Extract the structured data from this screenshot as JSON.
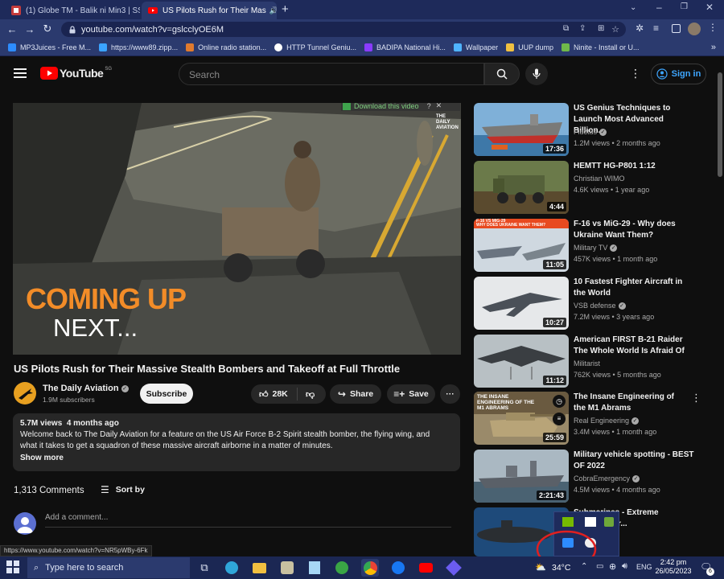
{
  "browser": {
    "tabs": [
      {
        "label": "(1) Globe TM - Balik ni Min3 | SS",
        "active": false
      },
      {
        "label": "US Pilots Rush for Their Mas",
        "active": true
      }
    ],
    "url": "youtube.com/watch?v=gslcclyOE6M",
    "bookmarks": [
      "MP3Juices - Free M...",
      "https://www89.zipp...",
      "Online radio station...",
      "HTTP Tunnel Geniu...",
      "BADIPA National Hi...",
      "Wallpaper",
      "UUP dump",
      "Ninite - Install or U..."
    ],
    "status_url": "https://www.youtube.com/watch?v=NR5pWBy-6Fk"
  },
  "youtube": {
    "logo": "YouTube",
    "region": "SG",
    "search_placeholder": "Search",
    "signin": "Sign in"
  },
  "player": {
    "download_label": "Download this video",
    "overlay_line1": "COMING UP",
    "overlay_line2": "NEXT...",
    "watermark_line1": "THE",
    "watermark_line2": "DAILY",
    "watermark_line3": "AVIATION"
  },
  "video": {
    "title": "US Pilots Rush for Their Massive Stealth Bombers and Takeoff at Full Throttle",
    "channel": "The Daily Aviation",
    "subscribers": "1.9M subscribers",
    "subscribe": "Subscribe",
    "likes": "28K",
    "share": "Share",
    "save": "Save",
    "views": "5.7M views",
    "age": "4 months ago",
    "description": "Welcome back to The Daily Aviation for a feature on the US Air Force B-2 Spirit stealth bomber, the flying wing, and what it takes to get a squadron of these massive aircraft airborne in a matter of minutes.",
    "show_more": "Show more",
    "comments_count": "1,313 Comments",
    "sort_by": "Sort by",
    "add_comment": "Add a comment..."
  },
  "recommendations": [
    {
      "title": "US Genius Techniques to Launch Most Advanced Billion...",
      "channel": "Fluctus",
      "meta": "1.2M views • 2 months ago",
      "duration": "17:36",
      "verified": true
    },
    {
      "title": "HEMTT HG-P801 1:12",
      "channel": "Christian WIMO",
      "meta": "4.6K views • 1 year ago",
      "duration": "4:44",
      "verified": false
    },
    {
      "title": "F-16 vs MiG-29 - Why does Ukraine Want Them?",
      "channel": "Military TV",
      "meta": "457K views • 1 month ago",
      "duration": "11:05",
      "verified": true,
      "thumb_caption1": "F-16 VS MIG-29",
      "thumb_caption2": "WHY DOES UKRAINE WANT THEM?"
    },
    {
      "title": "10 Fastest Fighter Aircraft in the World",
      "channel": "VSB defense",
      "meta": "7.2M views • 3 years ago",
      "duration": "10:27",
      "verified": true
    },
    {
      "title": "American FIRST B-21 Raider The Whole World Is Afraid Of",
      "channel": "Militarist",
      "meta": "762K views • 5 months ago",
      "duration": "11:12",
      "verified": false
    },
    {
      "title": "The Insane Engineering of the M1 Abrams",
      "channel": "Real Engineering",
      "meta": "3.4M views • 1 month ago",
      "duration": "25:59",
      "verified": true,
      "thumb_caption1": "THE INSANE",
      "thumb_caption2": "ENGINEERING OF THE",
      "thumb_caption3": "M1 ABRAMS"
    },
    {
      "title": "Military vehicle spotting - BEST OF 2022",
      "channel": "CobraEmergency",
      "meta": "4.5M views • 4 months ago",
      "duration": "2:21:43",
      "verified": true
    },
    {
      "title": "Submarines - Extreme ...Big Bigger...",
      "channel": "",
      "meta": "",
      "duration": "",
      "verified": false
    }
  ],
  "taskbar": {
    "search_placeholder": "Type here to search",
    "temperature": "34°C",
    "language": "ENG",
    "time": "2:42 pm",
    "date": "26/05/2023",
    "notifications": "6"
  },
  "colors": {
    "brand_red": "#ff0000",
    "link_blue": "#3ea6ff",
    "overlay_orange": "#f28c28",
    "chrome_blue": "#2b3a6e"
  }
}
